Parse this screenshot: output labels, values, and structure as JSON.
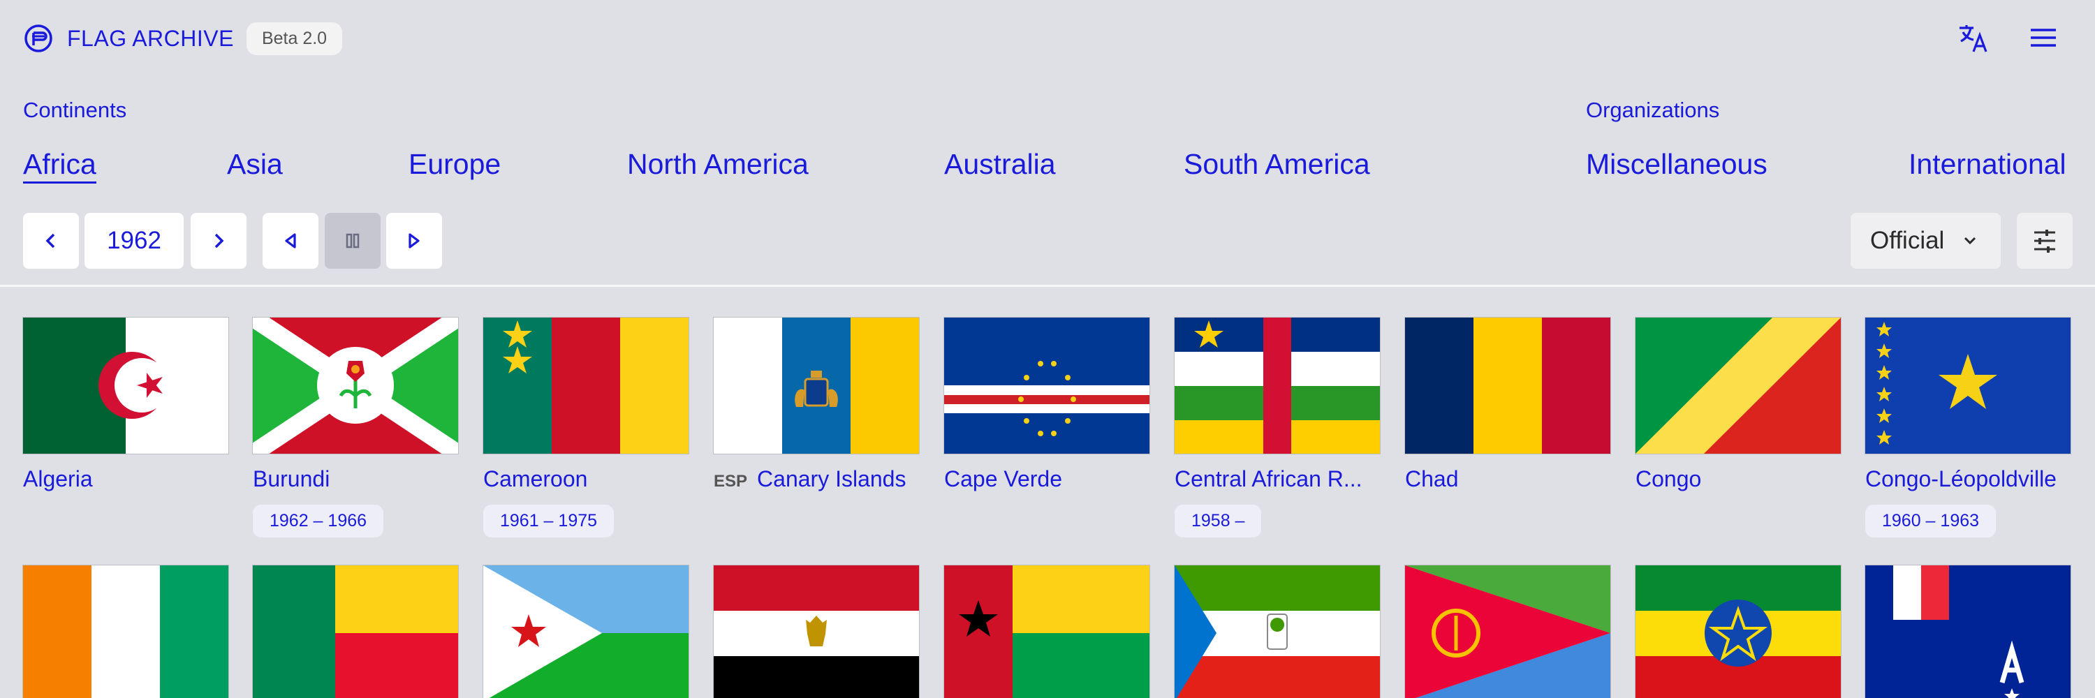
{
  "app": {
    "title": "FLAG ARCHIVE",
    "badge": "Beta 2.0"
  },
  "sections": {
    "continents_label": "Continents",
    "organizations_label": "Organizations"
  },
  "nav": {
    "africa": "Africa",
    "asia": "Asia",
    "europe": "Europe",
    "north_america": "North America",
    "australia": "Australia",
    "south_america": "South America",
    "miscellaneous": "Miscellaneous",
    "international": "International"
  },
  "controls": {
    "year": "1962",
    "mode": "Official"
  },
  "icons": {
    "logo": "flag-archive-logo-icon",
    "translate": "translate-icon",
    "menu": "hamburger-menu-icon",
    "prev": "chevron-left-icon",
    "next": "chevron-right-icon",
    "back": "play-back-icon",
    "pause": "pause-icon",
    "play": "play-icon",
    "dropdown": "chevron-down-icon",
    "filter": "sliders-icon"
  },
  "colors": {
    "accent": "#1a1adb",
    "background": "#dfe0e6"
  },
  "flags": [
    {
      "name": "Algeria",
      "prefix": "",
      "years": ""
    },
    {
      "name": "Burundi",
      "prefix": "",
      "years": "1962 – 1966"
    },
    {
      "name": "Cameroon",
      "prefix": "",
      "years": "1961 – 1975"
    },
    {
      "name": "Canary Islands",
      "prefix": "ESP",
      "years": ""
    },
    {
      "name": "Cape Verde",
      "prefix": "",
      "years": ""
    },
    {
      "name": "Central African R...",
      "prefix": "",
      "years": "1958 –"
    },
    {
      "name": "Chad",
      "prefix": "",
      "years": ""
    },
    {
      "name": "Congo",
      "prefix": "",
      "years": ""
    },
    {
      "name": "Congo-Léopoldville",
      "prefix": "",
      "years": "1960 – 1963"
    }
  ]
}
